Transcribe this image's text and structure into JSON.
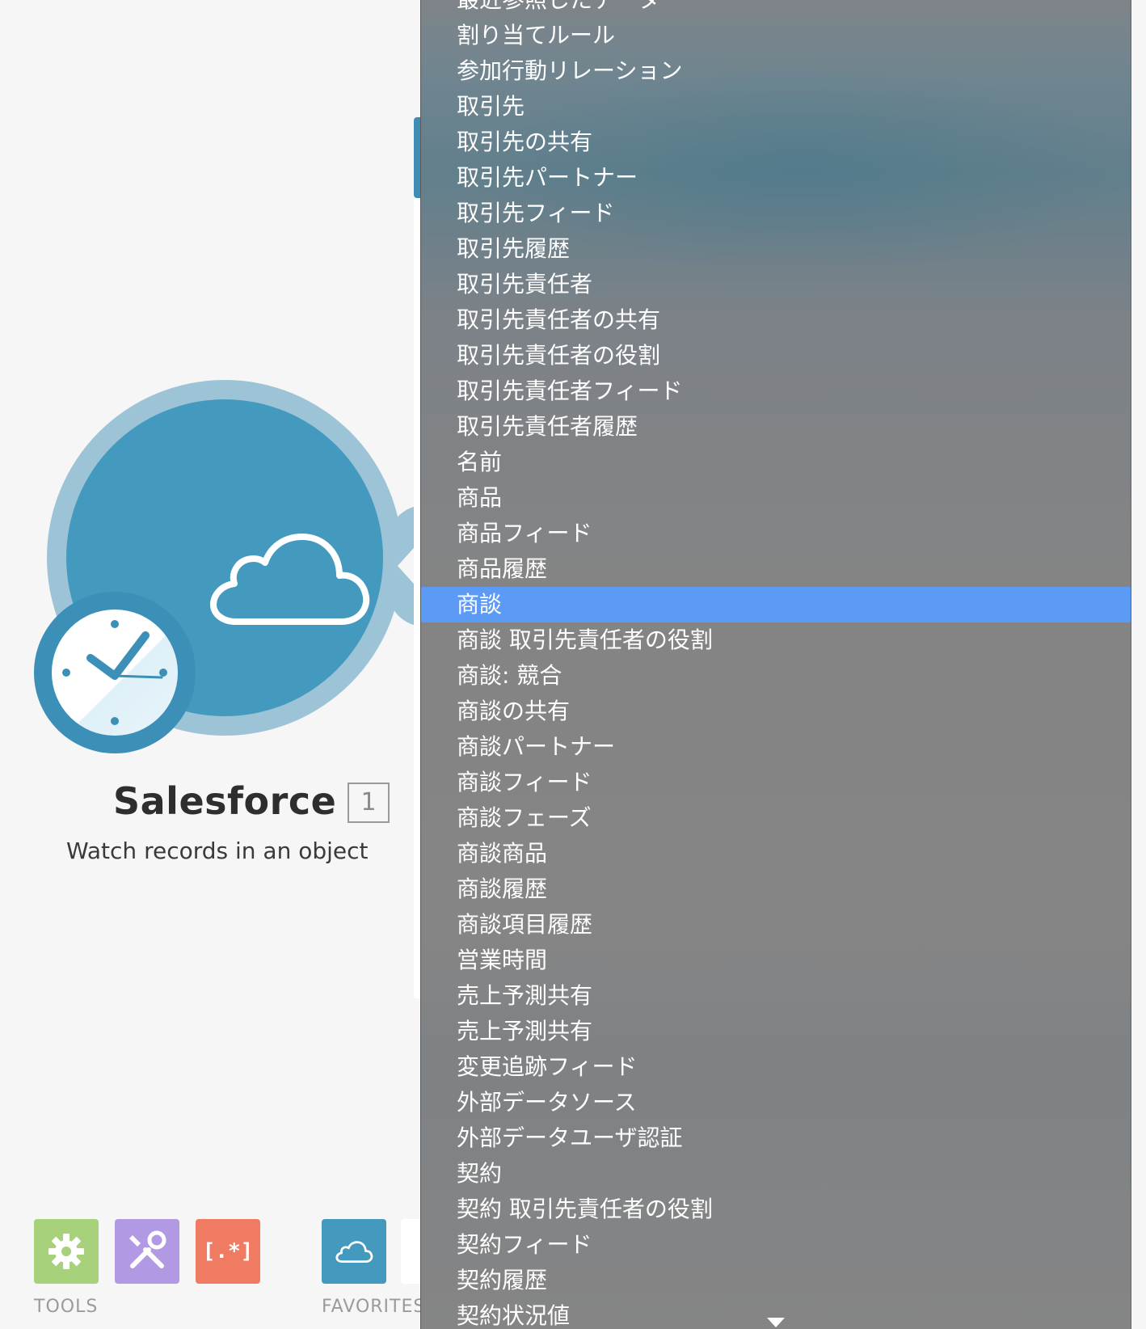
{
  "module": {
    "title": "Salesforce",
    "badge": "1",
    "subtitle": "Watch records in an object",
    "colors": {
      "core": "#4499bf",
      "halo": "#9dc3d7",
      "clock_ring": "#3c90b8"
    },
    "icons": [
      "cloud-icon",
      "clock-icon"
    ]
  },
  "toolbar": {
    "tools_label": "TOOLS",
    "favorites_label": "FAVORITES",
    "buttons": [
      {
        "name": "tools-settings",
        "icon": "gear-icon",
        "color": "#a8d17c"
      },
      {
        "name": "tools-flow-control",
        "icon": "crossed-tools-icon",
        "color": "#b199e3"
      },
      {
        "name": "tools-text-parser",
        "icon": "regex-brackets-icon",
        "color": "#ef7b63",
        "glyph": "[.*]"
      },
      {
        "name": "favorites-salesforce",
        "icon": "cloud-icon",
        "color": "#4499bf"
      }
    ]
  },
  "dropdown": {
    "selected_index": 17,
    "selected_color": "#5b9bf6",
    "items": [
      "最近参照したデータ",
      "割り当てルール",
      "参加行動リレーション",
      "取引先",
      "取引先の共有",
      "取引先パートナー",
      "取引先フィード",
      "取引先履歴",
      "取引先責任者",
      "取引先責任者の共有",
      "取引先責任者の役割",
      "取引先責任者フィード",
      "取引先責任者履歴",
      "名前",
      "商品",
      "商品フィード",
      "商品履歴",
      "商談",
      "商談 取引先責任者の役割",
      "商談: 競合",
      "商談の共有",
      "商談パートナー",
      "商談フィード",
      "商談フェーズ",
      "商談商品",
      "商談履歴",
      "商談項目履歴",
      "営業時間",
      "売上予測共有",
      "売上予測共有",
      "変更追跡フィード",
      "外部データソース",
      "外部データユーザ認証",
      "契約",
      "契約 取引先責任者の役割",
      "契約フィード",
      "契約履歴",
      "契約状況値"
    ]
  }
}
